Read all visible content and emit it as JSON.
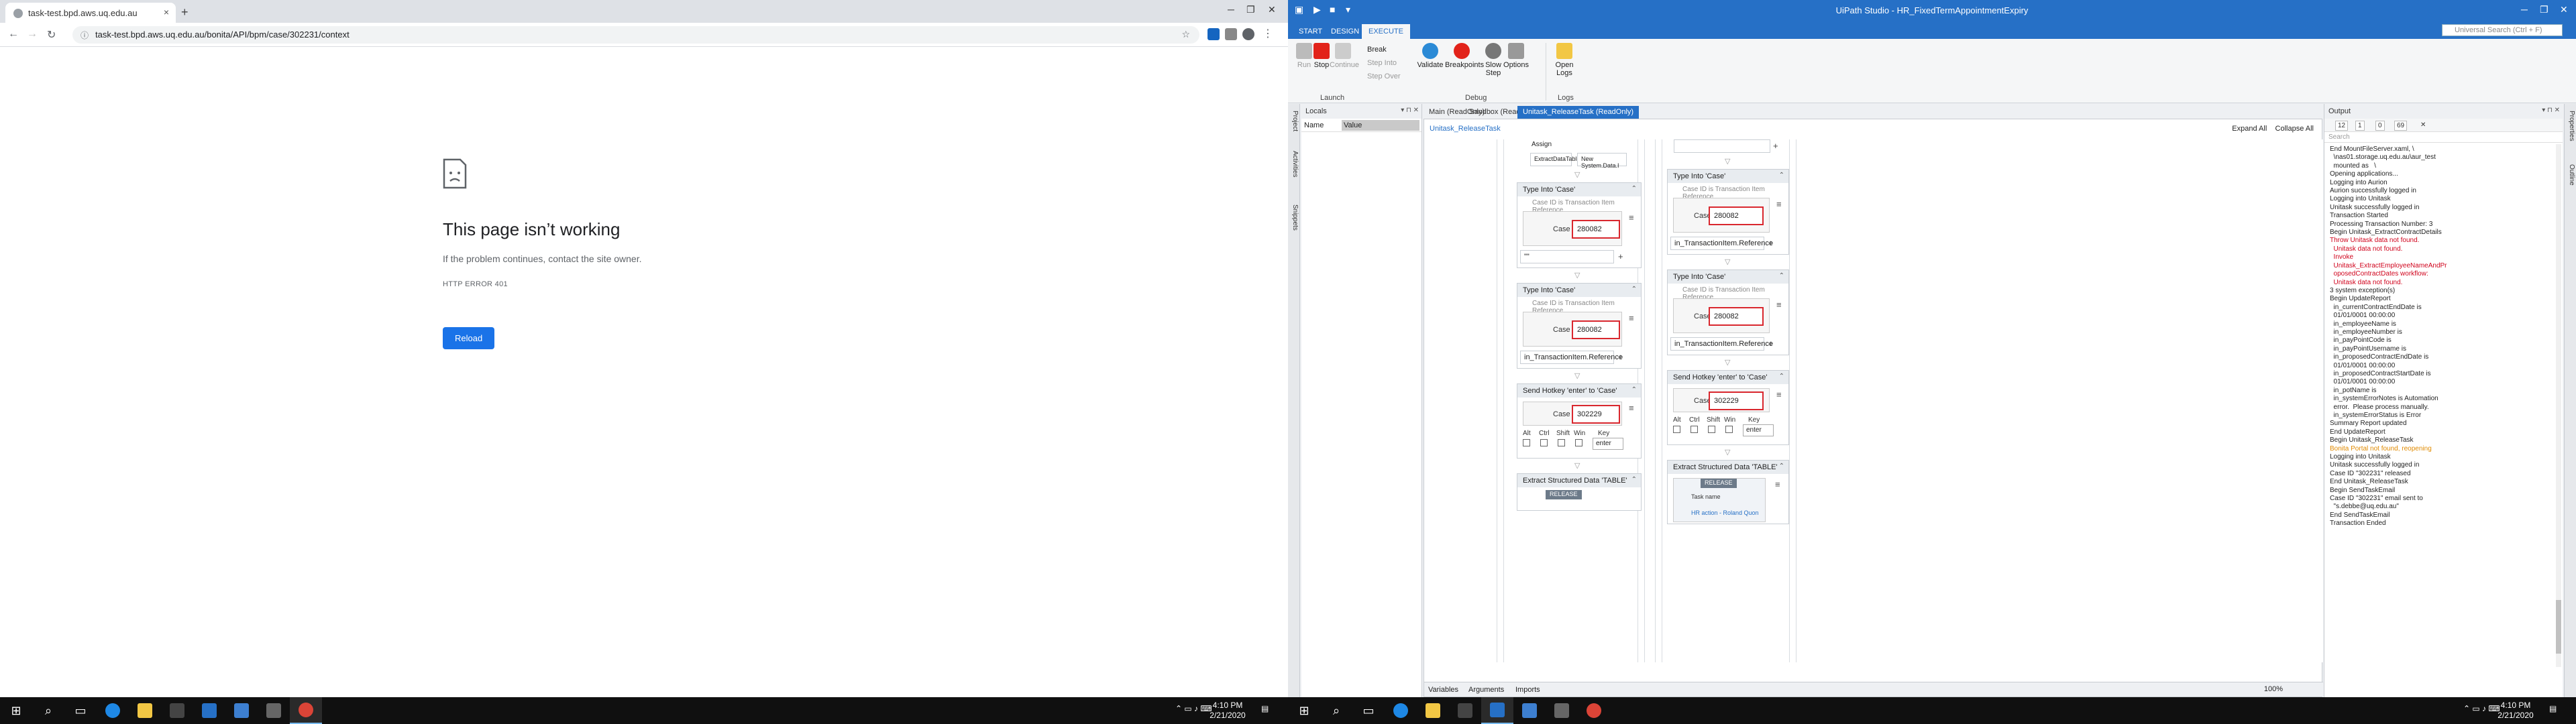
{
  "chrome": {
    "tab_title": "task-test.bpd.aws.uq.edu.au",
    "url": "task-test.bpd.aws.uq.edu.au/bonita/API/bpm/case/302231/context",
    "error_title": "This page isn’t working",
    "error_sub": "If the problem continues, contact the site owner.",
    "error_code": "HTTP ERROR 401",
    "reload_label": "Reload"
  },
  "taskbar": {
    "time": "4:10 PM",
    "date": "2/21/2020"
  },
  "uipath": {
    "window_title": "UiPath Studio - HR_FixedTermAppointmentExpiry",
    "search_placeholder": "Universal Search (Ctrl + F)",
    "ribbon_tabs": [
      "START",
      "DESIGN",
      "EXECUTE"
    ],
    "ribbon": {
      "run": "Run",
      "stop": "Stop",
      "continue": "Continue",
      "break": "Break",
      "step_into": "Step Into",
      "step_over": "Step Over",
      "validate": "Validate",
      "breakpoints": "Breakpoints",
      "slow_step": "Slow Step",
      "options": "Options",
      "open_logs": "Open Logs",
      "group_launch": "Launch",
      "group_debug": "Debug",
      "group_logs": "Logs"
    },
    "side_tabs": [
      "Project",
      "Activities",
      "Snippets"
    ],
    "right_tabs": [
      "Properties",
      "Outline"
    ],
    "locals": {
      "title": "Locals",
      "col_name": "Name",
      "col_value": "Value"
    },
    "doc_tabs": [
      "Main (ReadOnly)",
      "Sandbox (ReadOnly)",
      "Unitask_ReleaseTask (ReadOnly)"
    ],
    "breadcrumb": "Unitask_ReleaseTask",
    "expand_all": "Expand All",
    "collapse_all": "Collapse All",
    "canvas": {
      "assign_title": "Assign",
      "assign_left": "ExtractDataTable",
      "assign_right": "New System.Data.I",
      "type_into": "Type Into 'Case'",
      "hint": "Case ID is Transaction Item Reference",
      "case_label": "Case",
      "case_value": "280082",
      "expr_blank": "\"\"",
      "expr_ref": "in_TransactionItem.Reference",
      "send_hotkey": "Send Hotkey 'enter' to 'Case'",
      "case_value2": "302229",
      "alt": "Alt",
      "ctrl": "Ctrl",
      "shift": "Shift",
      "win": "Win",
      "key": "Key",
      "key_value": "enter",
      "extract": "Extract Structured Data 'TABLE'",
      "release": "RELEASE",
      "task_name": "Task name",
      "hr_action": "HR action - Roland Quon"
    },
    "bottom_tabs": [
      "Variables",
      "Arguments",
      "Imports"
    ],
    "zoom": "100%",
    "output": {
      "title": "Output",
      "badges": [
        "12",
        "1",
        "0",
        "69"
      ],
      "search_placeholder": "Search",
      "lines": [
        {
          "t": "End MountFileServer.xaml, \\",
          "c": ""
        },
        {
          "t": "  \\nas01.storage.uq.edu.au\\aur_test",
          "c": ""
        },
        {
          "t": "  mounted as   \\",
          "c": ""
        },
        {
          "t": "Opening applications...",
          "c": ""
        },
        {
          "t": "Logging into Aurion",
          "c": ""
        },
        {
          "t": "Aurion successfully logged in",
          "c": ""
        },
        {
          "t": "Logging into Unitask",
          "c": ""
        },
        {
          "t": "Unitask successfully logged in",
          "c": ""
        },
        {
          "t": "Transaction Started",
          "c": ""
        },
        {
          "t": "Processing Transaction Number: 3",
          "c": ""
        },
        {
          "t": "Begin Unitask_ExtractContractDetails",
          "c": ""
        },
        {
          "t": "Throw Unitask data not found.",
          "c": "err"
        },
        {
          "t": "  Unitask data not found.",
          "c": "err"
        },
        {
          "t": "  Invoke",
          "c": "err"
        },
        {
          "t": "  Unitask_ExtractEmployeeNameAndPr",
          "c": "err"
        },
        {
          "t": "  oposedContractDates workflow:",
          "c": "err"
        },
        {
          "t": "  Unitask data not found.",
          "c": "err"
        },
        {
          "t": "3 system exception(s)",
          "c": ""
        },
        {
          "t": "Begin UpdateReport",
          "c": ""
        },
        {
          "t": "  in_currentContractEndDate is",
          "c": ""
        },
        {
          "t": "  01/01/0001 00:00:00",
          "c": ""
        },
        {
          "t": "  in_employeeName is",
          "c": ""
        },
        {
          "t": "  in_employeeNumber is",
          "c": ""
        },
        {
          "t": "  in_payPointCode is",
          "c": ""
        },
        {
          "t": "  in_payPointUsername is",
          "c": ""
        },
        {
          "t": "  in_proposedContractEndDate is",
          "c": ""
        },
        {
          "t": "  01/01/0001 00:00:00",
          "c": ""
        },
        {
          "t": "  in_proposedContractStartDate is",
          "c": ""
        },
        {
          "t": "  01/01/0001 00:00:00",
          "c": ""
        },
        {
          "t": "  in_potName is",
          "c": ""
        },
        {
          "t": "  in_systemErrorNotes is Automation",
          "c": ""
        },
        {
          "t": "  error.  Please process manually.",
          "c": ""
        },
        {
          "t": "  in_systemErrorStatus is Error",
          "c": ""
        },
        {
          "t": "Summary Report updated",
          "c": ""
        },
        {
          "t": "End UpdateReport",
          "c": ""
        },
        {
          "t": "Begin Unitask_ReleaseTask",
          "c": ""
        },
        {
          "t": "Bonita Portal not found, reopening",
          "c": "warn"
        },
        {
          "t": "Logging into Unitask",
          "c": ""
        },
        {
          "t": "Unitask successfully logged in",
          "c": ""
        },
        {
          "t": "Case ID \"302231\" released",
          "c": ""
        },
        {
          "t": "End Unitask_ReleaseTask",
          "c": ""
        },
        {
          "t": "Begin SendTaskEmail",
          "c": ""
        },
        {
          "t": "Case ID \"302231\" email sent to",
          "c": ""
        },
        {
          "t": "  \"s.debbe@uq.edu.au\"",
          "c": ""
        },
        {
          "t": "End SendTaskEmail",
          "c": ""
        },
        {
          "t": "Transaction Ended",
          "c": ""
        }
      ]
    }
  }
}
